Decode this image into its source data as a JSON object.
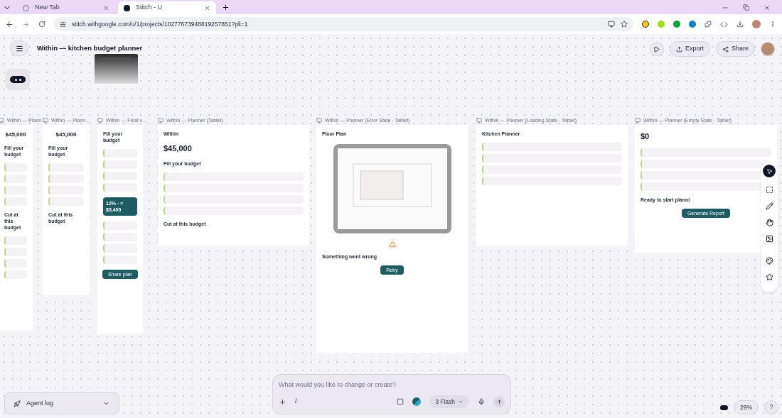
{
  "browser": {
    "tabs": [
      {
        "title": "New Tab",
        "selected": false
      },
      {
        "title": "Stitch - U",
        "selected": true
      }
    ],
    "url": "stitch.withgoogle.com/u/1/projects/10277673948819257851?pli=1"
  },
  "header": {
    "project_title": "Within — kitchen budget planner",
    "buttons": [
      "Export",
      "Share"
    ]
  },
  "frames": [
    {
      "label": "Within — Plann...",
      "kind": "phone",
      "items": [
        {
          "kind": "amount",
          "text": "$45,000"
        },
        {
          "kind": "heading",
          "text": "Fill your budget"
        },
        {
          "kind": "rows"
        },
        {
          "kind": "heading",
          "text": "Cut at this budget"
        },
        {
          "kind": "rows"
        }
      ]
    },
    {
      "label": "Within — Plann...",
      "kind": "phone",
      "items": [
        {
          "kind": "amount",
          "text": "$45,000"
        },
        {
          "kind": "heading",
          "text": "Fill your budget"
        },
        {
          "kind": "rows"
        },
        {
          "kind": "heading",
          "text": "Cut at this budget"
        }
      ]
    },
    {
      "label": "Within — Final v...",
      "kind": "phone",
      "items": [
        {
          "kind": "heading",
          "text": "Fill your budget"
        },
        {
          "kind": "rows"
        },
        {
          "kind": "banner",
          "text": "12% · ≈ $5,400"
        },
        {
          "kind": "rows"
        },
        {
          "kind": "button",
          "text": "Share plan"
        }
      ]
    },
    {
      "label": "Within — Planner (Tablet)",
      "kind": "tablet",
      "items": [
        {
          "kind": "heading",
          "text": "Within"
        },
        {
          "kind": "amount",
          "text": "$45,000"
        },
        {
          "kind": "heading",
          "text": "Fill your budget"
        },
        {
          "kind": "rows"
        },
        {
          "kind": "heading",
          "text": "Cut at this budget"
        }
      ]
    },
    {
      "label": "Within — Planner (Error State - Tablet)",
      "kind": "error",
      "items": [
        {
          "kind": "heading",
          "text": "Floor Plan"
        },
        {
          "kind": "drawing"
        },
        {
          "kind": "warning"
        },
        {
          "kind": "heading",
          "text": "Something went wrong"
        },
        {
          "kind": "button",
          "text": "Retry"
        }
      ]
    },
    {
      "label": "Within — Planner (Loading State - Tablet)",
      "kind": "tablet",
      "items": [
        {
          "kind": "heading",
          "text": "Kitchen Planner"
        },
        {
          "kind": "rows"
        }
      ]
    },
    {
      "label": "Within — Planner (Empty State - Tablet)",
      "kind": "tablet",
      "items": [
        {
          "kind": "amount",
          "text": "$0"
        },
        {
          "kind": "rows"
        },
        {
          "kind": "heading",
          "text": "Ready to start planni"
        },
        {
          "kind": "button",
          "text": "Generate Report"
        }
      ]
    }
  ],
  "agent_log": {
    "label": "Agent log"
  },
  "prompt": {
    "placeholder": "What would you like to change or create?",
    "model": "3 Flash",
    "slash": "/"
  },
  "zoom": "29%",
  "help": "?"
}
